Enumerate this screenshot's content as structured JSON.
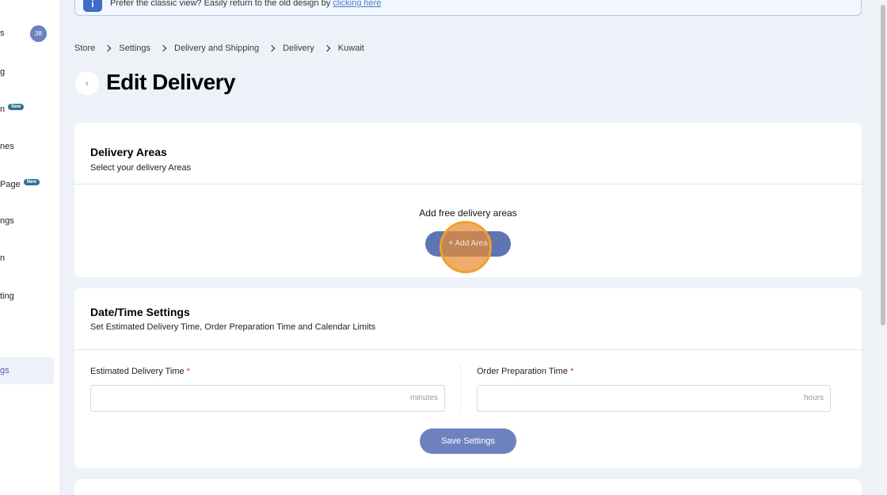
{
  "sidebar": {
    "items": [
      {
        "label": "s",
        "badge": "38"
      },
      {
        "label": "g"
      },
      {
        "label": "n",
        "tag": "New"
      },
      {
        "label": "nes"
      },
      {
        "label": "Page",
        "tag": "New"
      },
      {
        "label": "ngs"
      },
      {
        "label": "n"
      },
      {
        "label": "ting"
      },
      {
        "label": "gs",
        "active": true
      }
    ]
  },
  "banner": {
    "icon": "info-icon",
    "text": "Prefer the classic view? Easily return to the old design by ",
    "link": "clicking here"
  },
  "breadcrumb": [
    "Store",
    "Settings",
    "Delivery and Shipping",
    "Delivery",
    "Kuwait"
  ],
  "page": {
    "back_icon": "‹",
    "title": "Edit Delivery"
  },
  "delivery_areas": {
    "title": "Delivery Areas",
    "subtitle": "Select your delivery Areas",
    "empty_text": "Add free delivery areas",
    "add_button": "+ Add Area"
  },
  "datetime": {
    "title": "Date/Time Settings",
    "subtitle": "Set Estimated Delivery Time, Order Preparation Time and Calendar Limits",
    "estimated": {
      "label": "Estimated Delivery Time",
      "required": "*",
      "value": "",
      "unit": "minutes"
    },
    "preparation": {
      "label": "Order Preparation Time",
      "required": "*",
      "value": "",
      "unit": "hours"
    },
    "save_button": "Save Settings"
  },
  "colors": {
    "primary": "#5e74b3",
    "sidebar_active_text": "#4a62a8",
    "new_badge": "#2f6f91",
    "required": "#d12f2f",
    "cursor_highlight": "#f0a030"
  }
}
